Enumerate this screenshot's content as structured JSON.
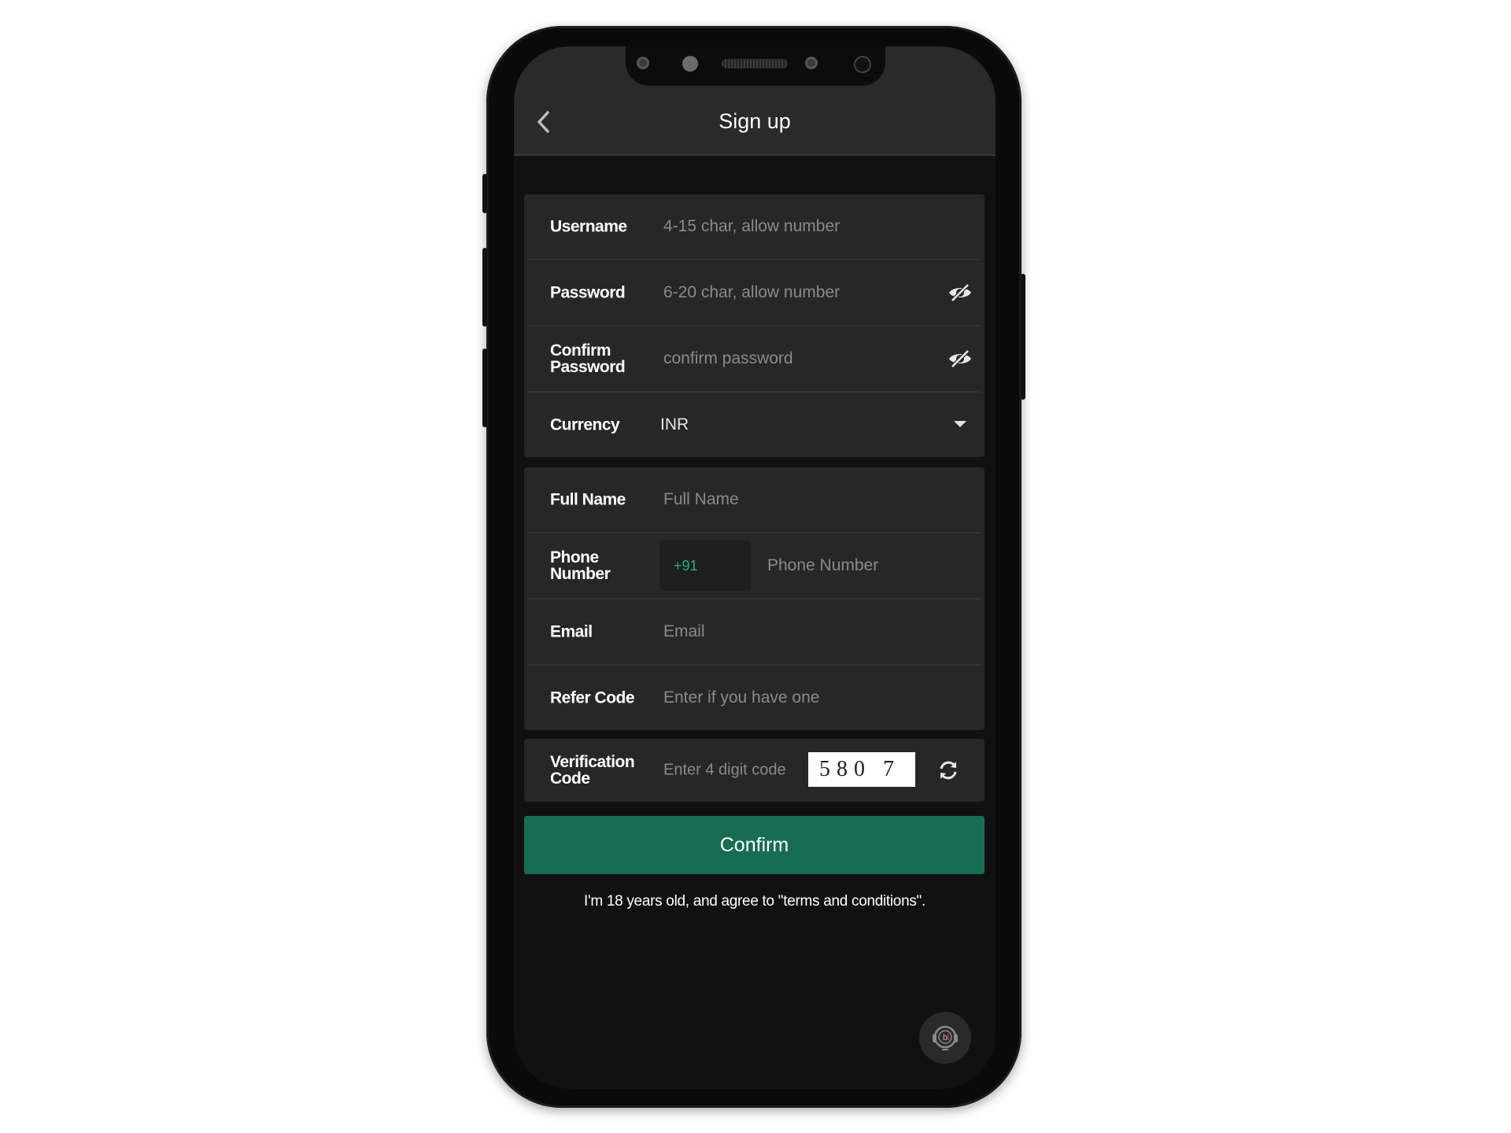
{
  "header": {
    "title": "Sign up",
    "back_icon": "chevron-left-icon"
  },
  "account_group": {
    "username": {
      "label": "Username",
      "placeholder": "4-15 char, allow number",
      "value": ""
    },
    "password": {
      "label": "Password",
      "placeholder": "6-20 char, allow number",
      "value": "",
      "toggle_icon": "eye-slash-icon"
    },
    "confirm_password": {
      "label": "Confirm Password",
      "placeholder": "confirm password",
      "value": "",
      "toggle_icon": "eye-slash-icon"
    },
    "currency": {
      "label": "Currency",
      "selected": "INR",
      "icon": "caret-down-icon"
    }
  },
  "profile_group": {
    "full_name": {
      "label": "Full Name",
      "placeholder": "Full Name",
      "value": ""
    },
    "phone": {
      "label": "Phone Number",
      "country_code": "+91",
      "placeholder": "Phone Number",
      "value": ""
    },
    "email": {
      "label": "Email",
      "placeholder": "Email",
      "value": ""
    },
    "refer_code": {
      "label": "Refer Code",
      "placeholder": "Enter if you have one",
      "value": ""
    }
  },
  "verification": {
    "label": "Verification Code",
    "placeholder": "Enter 4 digit code",
    "value": "",
    "captcha": "580 7",
    "refresh_icon": "refresh-icon"
  },
  "confirm_button": {
    "label": "Confirm"
  },
  "terms_text": "I'm 18 years old, and agree to \"terms and conditions\".",
  "support_button": {
    "icon": "headset-support-icon"
  },
  "colors": {
    "accent": "#166d51",
    "country_code": "#21b07a",
    "panel": "#272727",
    "background": "#111111"
  }
}
